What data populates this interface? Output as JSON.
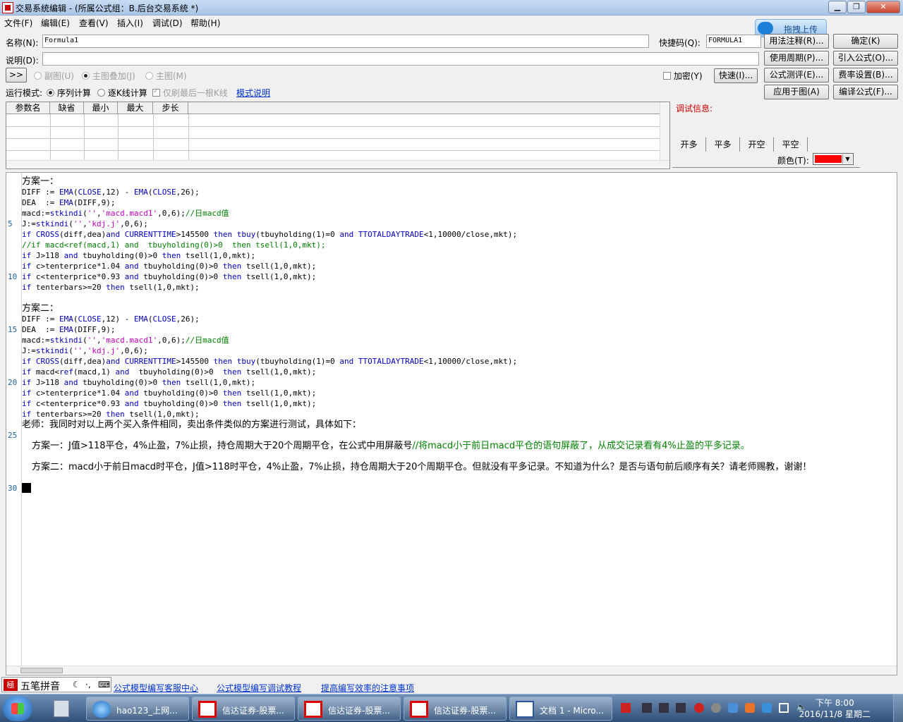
{
  "window": {
    "title": "交易系统编辑 - (所属公式组：B.后台交易系统 *)"
  },
  "menu": [
    "文件(F)",
    "编辑(E)",
    "查看(V)",
    "插入(I)",
    "调试(D)",
    "帮助(H)"
  ],
  "upload_badge": "拖拽上传",
  "form": {
    "name_label": "名称(N):",
    "name_value": "Formula1",
    "shortcut_label": "快捷码(Q):",
    "shortcut_value": "FORMULA1",
    "desc_label": "说明(D):",
    "desc_value": "",
    "expand_button": ">>",
    "chart_options": [
      "副图(U)",
      "主图叠加(J)",
      "主图(M)"
    ],
    "encrypt_label": "加密(Y)",
    "fast_button": "快速(I)...",
    "mode_label": "运行模式:",
    "mode_options": [
      "序列计算",
      "逐K线计算"
    ],
    "last_bar_only": "仅刷最后一根K线",
    "mode_help_link": "模式说明"
  },
  "right_buttons": {
    "usage_note": "用法注释(R)...",
    "ok": "确定(K)",
    "period": "使用周期(P)...",
    "import": "引入公式(O)...",
    "test": "公式测评(E)...",
    "fee": "费率设置(B)...",
    "apply": "应用于图(A)",
    "compile": "编译公式(F)..."
  },
  "param_table": {
    "headers": [
      "参数名",
      "缺省",
      "最小",
      "最大",
      "步长"
    ]
  },
  "debug": {
    "title": "调试信息:",
    "tabs": [
      "开多",
      "平多",
      "开空",
      "平空"
    ],
    "color_label": "颜色(T):",
    "color_value": "#ff0000"
  },
  "editor": {
    "line_numbers": [
      "5",
      "10",
      "15",
      "20",
      "25",
      "30"
    ],
    "lines": [
      "方案一：",
      "DIFF := EMA(CLOSE,12) - EMA(CLOSE,26);",
      "DEA  := EMA(DIFF,9);",
      "macd:=stkindi('','macd.macd1',0,6);//日macd值",
      "J:=stkindi('','kdj.j',0,6);",
      "if CROSS(diff,dea)and CURRENTTIME>145500 then tbuy(tbuyholding(1)=0 and TTOTALDAYTRADE<1,10000/close,mkt);",
      "//if macd<ref(macd,1) and  tbuyholding(0)>0  then tsell(1,0,mkt);",
      "if J>118 and tbuyholding(0)>0 then tsell(1,0,mkt);",
      "if c>tenterprice*1.04 and tbuyholding(0)>0 then tsell(1,0,mkt);",
      "if c<tenterprice*0.93 and tbuyholding(0)>0 then tsell(1,0,mkt);",
      "if tenterbars>=20 then tsell(1,0,mkt);",
      "方案二：",
      "DIFF := EMA(CLOSE,12) - EMA(CLOSE,26);",
      "DEA  := EMA(DIFF,9);",
      "macd:=stkindi('','macd.macd1',0,6);//日macd值",
      "J:=stkindi('','kdj.j',0,6);",
      "if CROSS(diff,dea)and CURRENTTIME>145500 then tbuy(tbuyholding(1)=0 and TTOTALDAYTRADE<1,10000/close,mkt);",
      "if macd<ref(macd,1) and  tbuyholding(0)>0  then tsell(1,0,mkt);",
      "if J>118 and tbuyholding(0)>0 then tsell(1,0,mkt);",
      "if c>tenterprice*1.04 and tbuyholding(0)>0 then tsell(1,0,mkt);",
      "if c<tenterprice*0.93 and tbuyholding(0)>0 then tsell(1,0,mkt);",
      "if tenterbars>=20 then tsell(1,0,mkt);",
      "老师：我同时对以上两个买入条件相同，卖出条件类似的方案进行测试，具体如下：",
      "方案一：J值>118平仓，4%止盈，7%止损，持仓周期大于20个周期平仓，在公式中用屏蔽号",
      "//将macd小于前日macd平仓的语句屏蔽了，从成交记录看有4%止盈的平多记录。",
      "方案二：macd小于前日macd时平仓，J值>118时平仓，4%止盈，7%止损，持仓周期大于20个周期平仓。但就没有平多记录。不知道为什么？是否与语句前后顺序有关？请老师赐教，谢谢！"
    ]
  },
  "ime": {
    "name": "五笔拼音"
  },
  "help_links": [
    "公式模型编写客服中心",
    "公式模型编写调试教程",
    "提高编写效率的注意事项"
  ],
  "taskbar": {
    "items": [
      "hao123_上网...",
      "信达证券-股票...",
      "信达证券-股票...",
      "信达证券-股票...",
      "文档 1 - Micro..."
    ],
    "time": "下午 8:00",
    "date": "2016/11/8 星期二"
  }
}
